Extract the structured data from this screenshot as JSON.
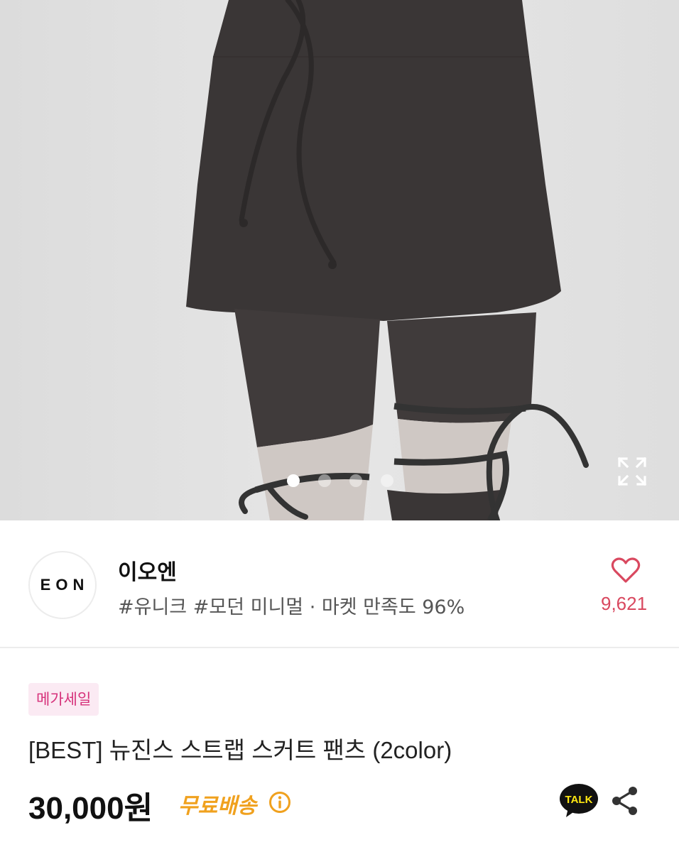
{
  "gallery": {
    "image_alt": "product-photo-black-skirt-pants-with-leg-straps",
    "slide_count": 4,
    "active_slide": 1,
    "expand_icon": "expand-icon"
  },
  "store": {
    "logo_text": "EON",
    "name": "이오엔",
    "tags": "#유니크 #모던 미니멀 · 마켓 만족도 96%",
    "like_icon": "heart-outline-icon",
    "like_count": "9,621"
  },
  "product": {
    "badge": "메가세일",
    "title": "[BEST] 뉴진스 스트랩 스커트 팬츠 (2color)",
    "price": "30,000원",
    "shipping": "무료배송",
    "shipping_info_icon": "info-icon",
    "talk_icon": "kakao-talk-icon",
    "talk_label": "TALK",
    "share_icon": "share-icon"
  },
  "colors": {
    "accent_pink": "#d6307a",
    "like_red": "#d9485f",
    "shipping_orange": "#f0a11e",
    "badge_bg": "#fbeaf3",
    "talk_yellow": "#ffe812"
  }
}
